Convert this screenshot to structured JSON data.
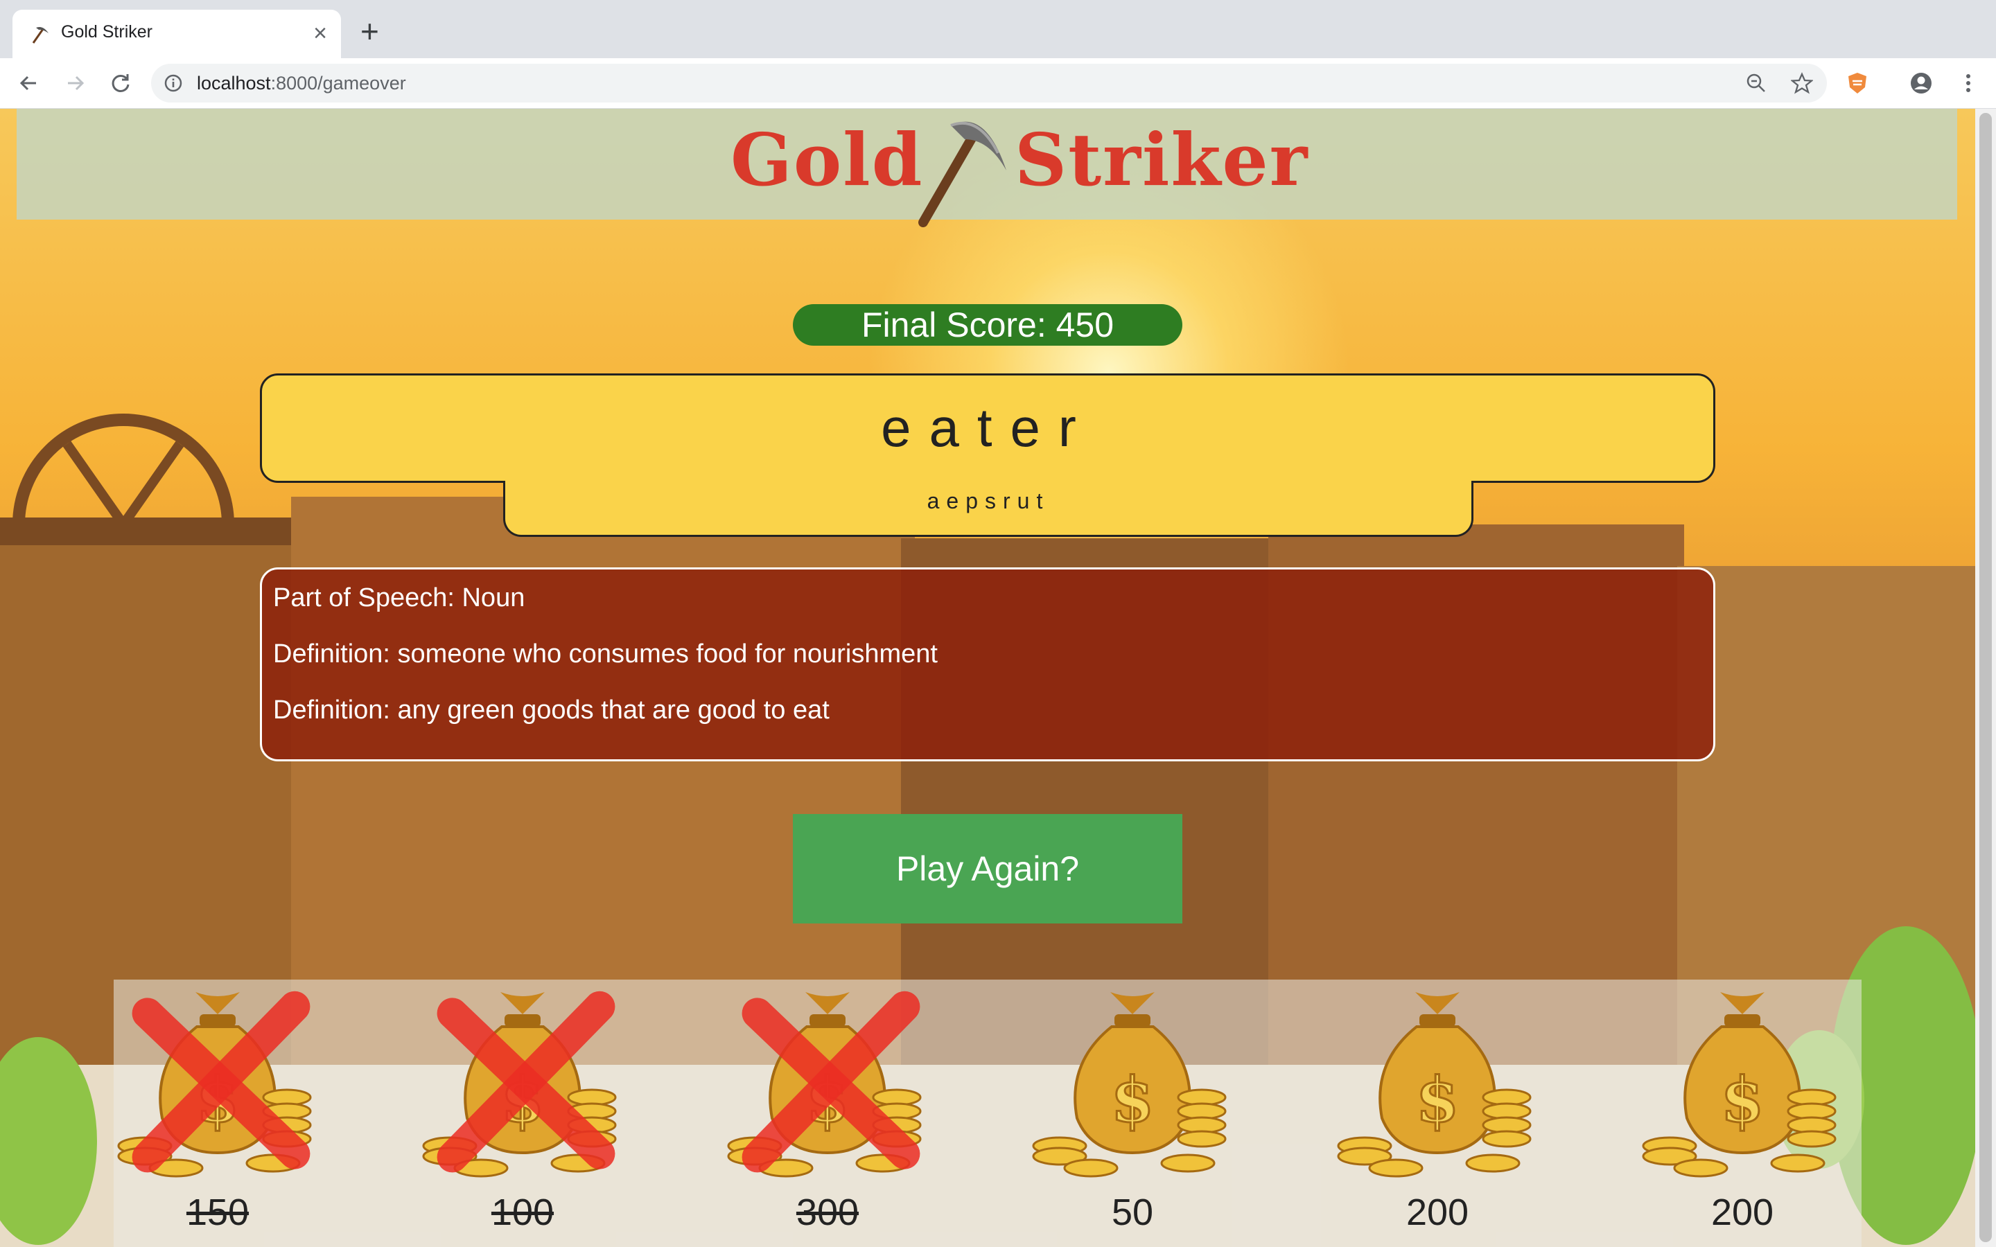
{
  "browser": {
    "tab": {
      "title": "Gold Striker",
      "favicon": "pickaxe-icon"
    },
    "address": {
      "host": "localhost",
      "path": ":8000/gameover"
    }
  },
  "game": {
    "logo": {
      "left": "Gold",
      "right": "Striker"
    },
    "final_score_label": "Final Score: 450",
    "word": "eater",
    "letters": "aepsrut",
    "definitions": [
      "Part of Speech: Noun",
      "Definition: someone who consumes food for nourishment",
      "Definition: any green goods that are good to eat"
    ],
    "play_again_label": "Play Again?",
    "bags": [
      {
        "value": "150",
        "crossed": true
      },
      {
        "value": "100",
        "crossed": true
      },
      {
        "value": "300",
        "crossed": true
      },
      {
        "value": "50",
        "crossed": false
      },
      {
        "value": "200",
        "crossed": false
      },
      {
        "value": "200",
        "crossed": false
      }
    ]
  },
  "colors": {
    "logo_red": "#d93a2b",
    "score_green": "#2e7d22",
    "word_yellow": "#fad34a",
    "definition_red": "#8c1e0a",
    "button_green": "#4aa553"
  }
}
